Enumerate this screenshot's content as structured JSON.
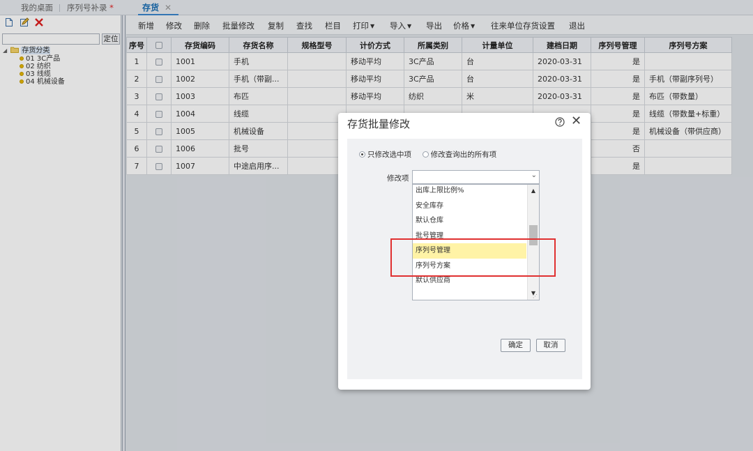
{
  "tabs": {
    "desktop": "我的桌面",
    "serial_supplement": "序列号补录",
    "dirty_mark": "*",
    "inventory": "存货",
    "close_glyph": "✕"
  },
  "left_panel": {
    "icons": [
      "new-doc-icon",
      "edit-doc-icon",
      "delete-x-icon"
    ],
    "locate_value": "",
    "locate_label": "定位",
    "tree": {
      "root": "存货分类",
      "nodes": [
        "01 3C产品",
        "02 纺织",
        "03 线缆",
        "04 机械设备"
      ]
    }
  },
  "toolbar": {
    "new": "新增",
    "modify": "修改",
    "delete": "删除",
    "batch_modify": "批量修改",
    "copy": "复制",
    "find": "查找",
    "columns": "栏目",
    "print": "打印",
    "import": "导入",
    "export": "导出",
    "price": "价格",
    "partner_settings": "往来单位存货设置",
    "exit": "退出"
  },
  "grid": {
    "headers": [
      "序号",
      "",
      "存货编码",
      "存货名称",
      "规格型号",
      "计价方式",
      "所属类别",
      "计量单位",
      "建档日期",
      "序列号管理",
      "序列号方案"
    ],
    "rows": [
      {
        "no": "1",
        "code": "1001",
        "name": "手机",
        "spec": "",
        "method": "移动平均",
        "category": "3C产品",
        "unit": "台",
        "date": "2020-03-31",
        "serial": "是",
        "scheme": ""
      },
      {
        "no": "2",
        "code": "1002",
        "name": "手机（带副...",
        "spec": "",
        "method": "移动平均",
        "category": "3C产品",
        "unit": "台",
        "date": "2020-03-31",
        "serial": "是",
        "scheme": "手机（带副序列号）"
      },
      {
        "no": "3",
        "code": "1003",
        "name": "布匹",
        "spec": "",
        "method": "移动平均",
        "category": "纺织",
        "unit": "米",
        "date": "2020-03-31",
        "serial": "是",
        "scheme": "布匹（带数量）"
      },
      {
        "no": "4",
        "code": "1004",
        "name": "线缆",
        "spec": "",
        "method": "",
        "category": "",
        "unit": "",
        "date": "",
        "serial": "是",
        "scheme": "线缆（带数量+标重）"
      },
      {
        "no": "5",
        "code": "1005",
        "name": "机械设备",
        "spec": "",
        "method": "",
        "category": "",
        "unit": "",
        "date": "",
        "serial": "是",
        "scheme": "机械设备（带供应商）"
      },
      {
        "no": "6",
        "code": "1006",
        "name": "批号",
        "spec": "",
        "method": "",
        "category": "",
        "unit": "",
        "date": "",
        "serial": "否",
        "scheme": ""
      },
      {
        "no": "7",
        "code": "1007",
        "name": "中途启用序...",
        "spec": "",
        "method": "",
        "category": "",
        "unit": "",
        "date": "",
        "serial": "是",
        "scheme": ""
      }
    ]
  },
  "dialog": {
    "title": "存货批量修改",
    "close_glyph": "✕",
    "radio_selected": "只修改选中项",
    "radio_all": "修改查询出的所有项",
    "field_label": "修改项",
    "select_value": "",
    "options": [
      "出库上限比例%",
      "安全库存",
      "默认仓库",
      "批号管理",
      "序列号管理",
      "序列号方案",
      "默认供应商"
    ],
    "highlighted_option": "序列号管理",
    "ok": "确定",
    "cancel": "取消"
  },
  "colors": {
    "accent": "#1a6fb5",
    "highlight": "#fff3a6",
    "annotation": "#e03030"
  }
}
